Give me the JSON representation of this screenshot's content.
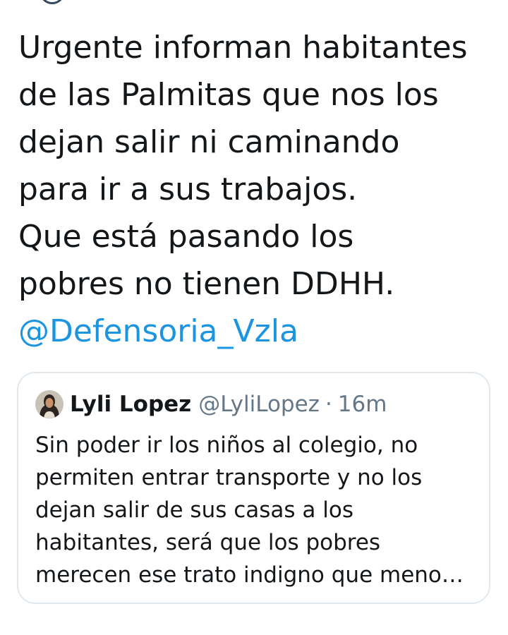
{
  "tweet": {
    "text": "Urgente informan habitantes\nde las Palmitas que nos los\ndejan salir ni caminando\npara ir a sus trabajos.\nQue está pasando los\npobres no tienen DDHH.",
    "mention": "@Defensoria_Vzla"
  },
  "quoted_tweet": {
    "author_name": "Lyli Lopez",
    "author_handle": "@LyliLopez",
    "separator": "·",
    "time": "16m",
    "text": "Sin poder ir los niños al colegio, no\npermiten entrar transporte y no los\ndejan salir de sus casas a los\nhabitantes, será que los pobres\nmerecen ese trato indigno que meno…"
  },
  "colors": {
    "text": "#14171a",
    "link": "#1b95e0",
    "secondary": "#657786",
    "border": "#e1e8ed"
  }
}
